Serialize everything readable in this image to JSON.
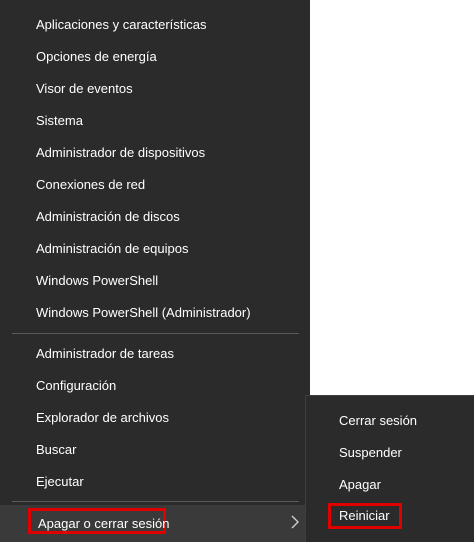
{
  "menu": {
    "items": [
      "Aplicaciones y características",
      "Opciones de energía",
      "Visor de eventos",
      "Sistema",
      "Administrador de dispositivos",
      "Conexiones de red",
      "Administración de discos",
      "Administración de equipos",
      "Windows PowerShell",
      "Windows PowerShell (Administrador)",
      "Administrador de tareas",
      "Configuración",
      "Explorador de archivos",
      "Buscar",
      "Ejecutar"
    ],
    "power": "Apagar o cerrar sesión"
  },
  "submenu": {
    "items": [
      "Cerrar sesión",
      "Suspender",
      "Apagar",
      "Reiniciar"
    ]
  },
  "colors": {
    "menu_bg": "#2b2b2b",
    "highlight_border": "#e00000",
    "text": "#ffffff"
  }
}
